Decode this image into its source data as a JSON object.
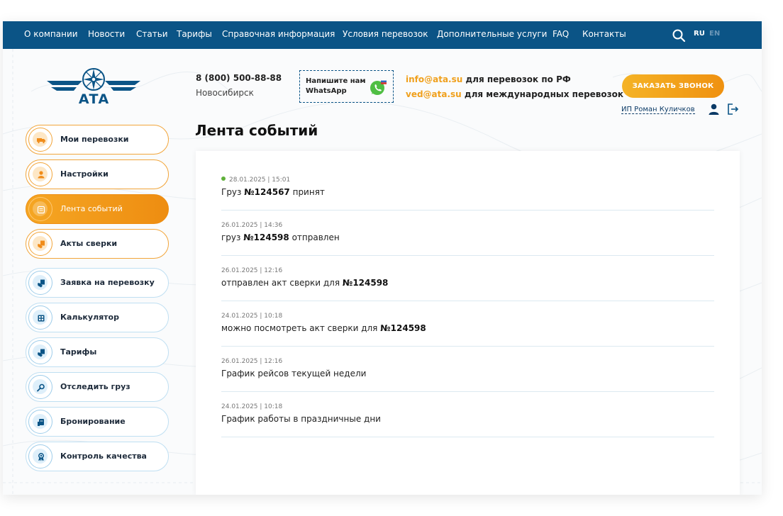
{
  "nav": {
    "items": [
      "О компании",
      "Новости",
      "Статьи",
      "Тарифы",
      "Справочная информация",
      "Условия перевозок",
      "Дополнительные услуги",
      "FAQ",
      "Контакты"
    ],
    "lang_active": "RU",
    "lang_inactive": "EN"
  },
  "header": {
    "logo_text": "АТА",
    "phone": "8 (800) 500-88-88",
    "city": "Новосибирск",
    "whatsapp_line1": "Напишите нам",
    "whatsapp_line2": "WhatsApp",
    "email1": "info@ata.su",
    "email1_desc": " для перевозок по РФ",
    "email2": "ved@ata.su",
    "email2_desc": " для международных перевозок",
    "order_button": "ЗАКАЗАТЬ ЗВОНОК",
    "user_name": "ИП Роман Куличков"
  },
  "sidebar": {
    "items": [
      {
        "label": "Мои перевозки",
        "icon": "truck-icon"
      },
      {
        "label": "Настройки",
        "icon": "person-icon"
      },
      {
        "label": "Лента событий",
        "icon": "feed-icon"
      },
      {
        "label": "Акты сверки",
        "icon": "hand-document-icon"
      },
      {
        "label": "Заявка на перевозку",
        "icon": "hand-document-icon"
      },
      {
        "label": "Калькулятор",
        "icon": "calculator-icon"
      },
      {
        "label": "Тарифы",
        "icon": "hand-document-icon"
      },
      {
        "label": "Отследить груз",
        "icon": "tracking-icon"
      },
      {
        "label": "Бронирование",
        "icon": "booking-icon"
      },
      {
        "label": "Контроль качества",
        "icon": "quality-icon"
      }
    ]
  },
  "main": {
    "title": "Лента событий",
    "events": [
      {
        "date": "28.01.2025",
        "time": "15:01",
        "pre": "Груз ",
        "num": "№124567",
        "post": " принят",
        "new": true
      },
      {
        "date": "26.01.2025",
        "time": "14:36",
        "pre": "груз ",
        "num": "№124598",
        "post": " отправлен",
        "new": false
      },
      {
        "date": "26.01.2025",
        "time": "12:16",
        "pre": "отправлен акт сверки для ",
        "num": "№124598",
        "post": "",
        "new": false
      },
      {
        "date": "24.01.2025",
        "time": "10:18",
        "pre": "можно посмотреть акт сверки для ",
        "num": "№124598",
        "post": "",
        "new": false
      },
      {
        "date": "26.01.2025",
        "time": "12:16",
        "pre": "График рейсов текущей недели",
        "num": "",
        "post": "",
        "new": false
      },
      {
        "date": "24.01.2025",
        "time": "10:18",
        "pre": "График работы в праздничные дни",
        "num": "",
        "post": "",
        "new": false
      }
    ]
  },
  "colors": {
    "nav_bg": "#0b5486",
    "accent": "#f0a01c",
    "new_dot": "#5fb03a"
  }
}
